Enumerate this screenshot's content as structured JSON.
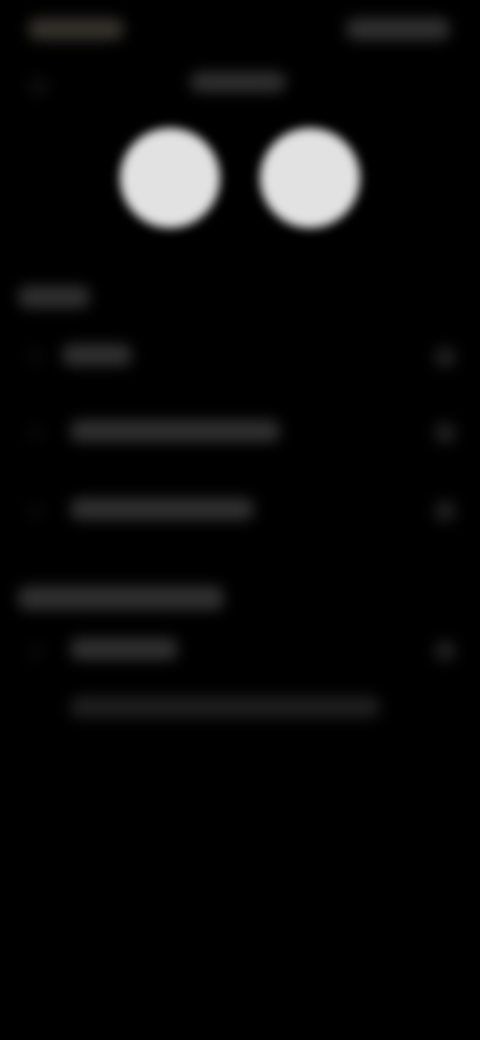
{
  "screen": {
    "background": "#000000",
    "accent_soft": "#d2c8aa",
    "note": ""
  },
  "status_bar": {
    "left_text": "",
    "right_text": ""
  },
  "header": {
    "title": ""
  },
  "profile": {
    "left_circle": "avatar-icon",
    "right_circle": "avatar-icon"
  },
  "section1": {
    "title": "",
    "items": [
      {
        "label": "",
        "trailing": ""
      },
      {
        "label": "",
        "trailing": ""
      },
      {
        "label": "",
        "trailing": ""
      }
    ]
  },
  "section2": {
    "title": "",
    "items": [
      {
        "label": "",
        "trailing": ""
      },
      {
        "label": "",
        "trailing": ""
      }
    ]
  }
}
